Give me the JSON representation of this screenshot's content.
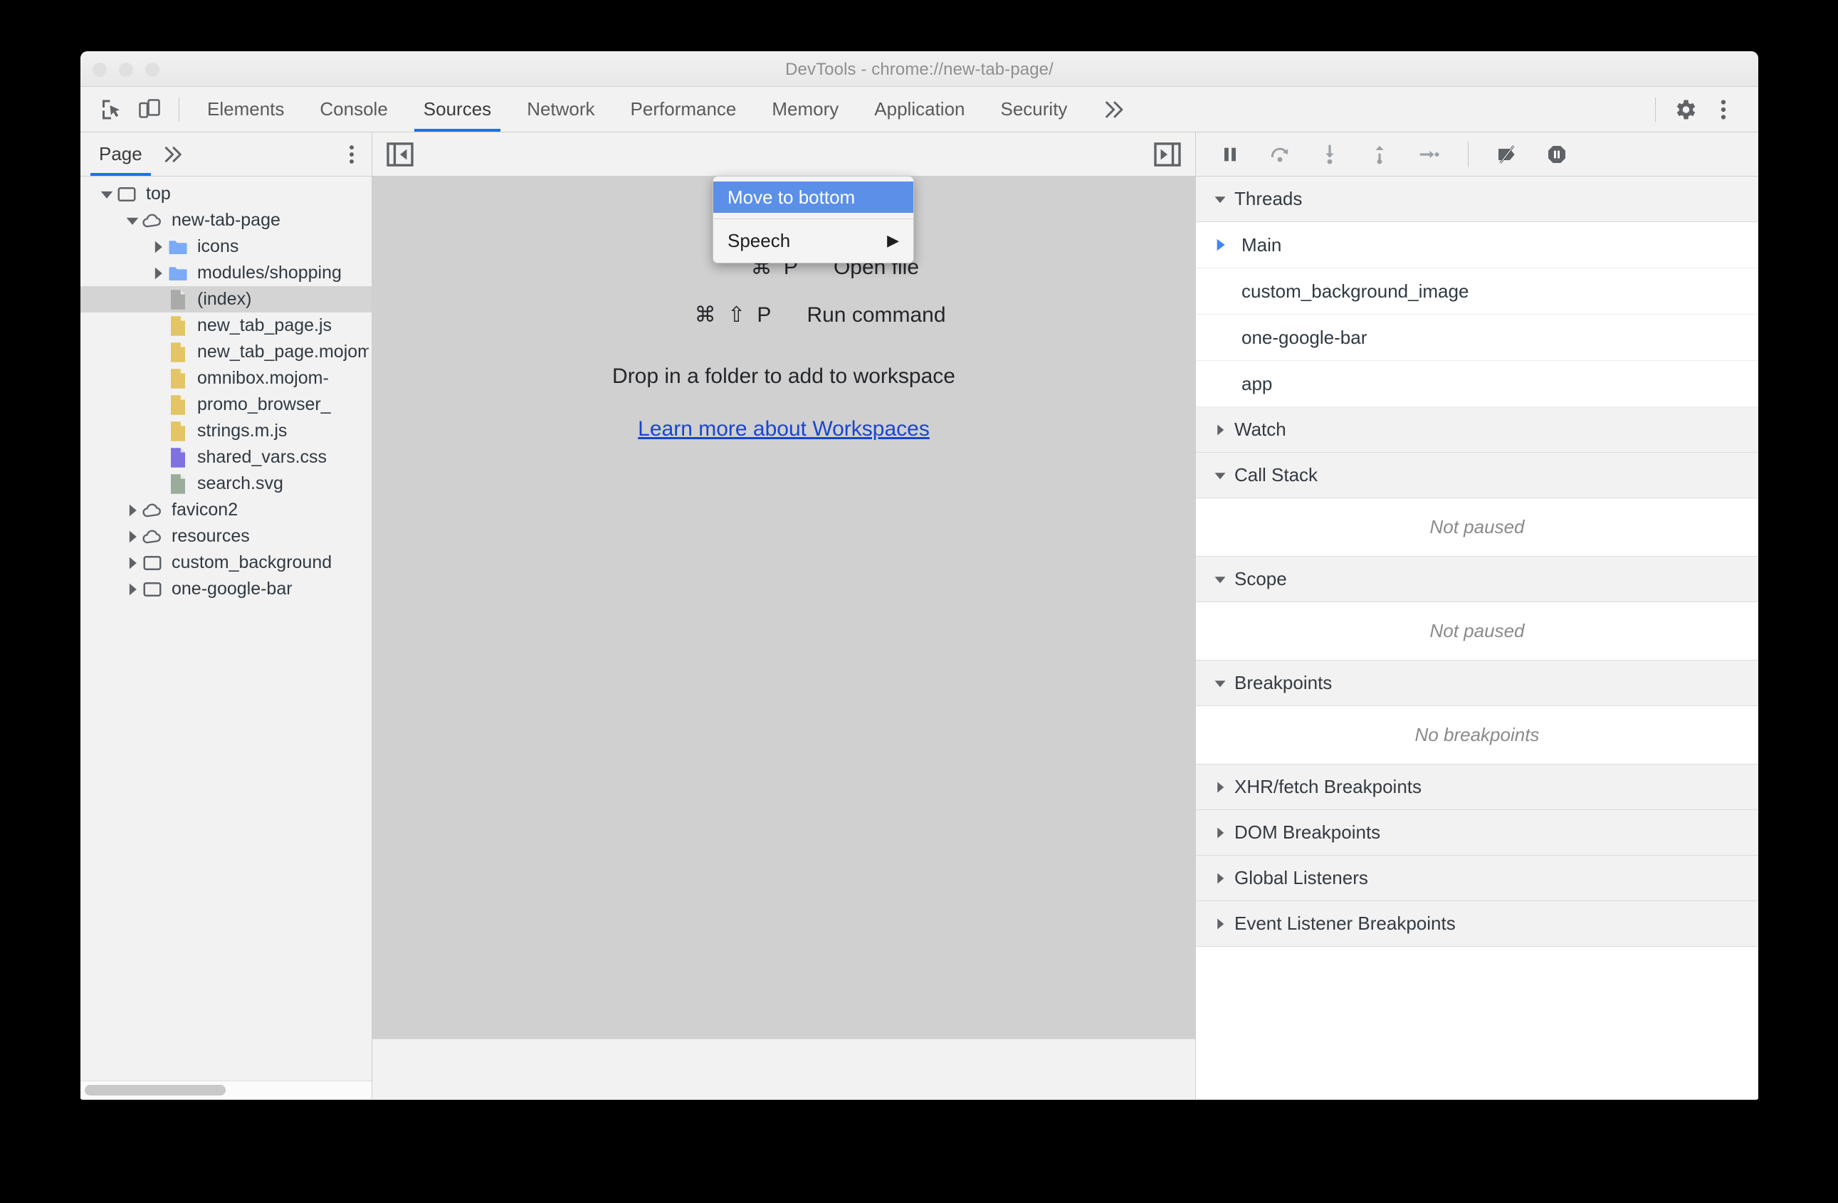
{
  "window": {
    "title": "DevTools - chrome://new-tab-page/",
    "traffic_lights": [
      "close",
      "minimize",
      "maximize"
    ]
  },
  "toolbar": {
    "inspect_icon": "inspect-cursor-icon",
    "device_icon": "device-toolbar-icon",
    "tabs": [
      {
        "label": "Elements",
        "active": false
      },
      {
        "label": "Console",
        "active": false
      },
      {
        "label": "Sources",
        "active": true
      },
      {
        "label": "Network",
        "active": false
      },
      {
        "label": "Performance",
        "active": false
      },
      {
        "label": "Memory",
        "active": false
      },
      {
        "label": "Application",
        "active": false
      },
      {
        "label": "Security",
        "active": false
      }
    ],
    "more_tabs_icon": "chevron-double-right-icon",
    "settings_icon": "gear-icon",
    "menu_icon": "kebab-menu-icon"
  },
  "context_menu": {
    "items": [
      {
        "label": "Move to bottom",
        "highlighted": true,
        "submenu": false
      },
      {
        "label": "Speech",
        "highlighted": false,
        "submenu": true
      }
    ],
    "submenu_arrow": "▶"
  },
  "navigator": {
    "tab_label": "Page",
    "more_icon": "chevron-double-right-icon",
    "kebab_icon": "kebab-menu-icon",
    "tree": [
      {
        "label": "top",
        "indent": 0,
        "arrow": "down",
        "icon": "frame-icon",
        "selected": false
      },
      {
        "label": "new-tab-page",
        "indent": 1,
        "arrow": "down",
        "icon": "cloud-icon",
        "selected": false
      },
      {
        "label": "icons",
        "indent": 2,
        "arrow": "right",
        "icon": "folder-icon",
        "selected": false
      },
      {
        "label": "modules/shopping",
        "indent": 2,
        "arrow": "right",
        "icon": "folder-icon",
        "selected": false
      },
      {
        "label": "(index)",
        "indent": 2,
        "arrow": "none",
        "icon": "doc-gray-icon",
        "selected": true
      },
      {
        "label": "new_tab_page.js",
        "indent": 2,
        "arrow": "none",
        "icon": "doc-js-icon",
        "selected": false
      },
      {
        "label": "new_tab_page.mojom",
        "indent": 2,
        "arrow": "none",
        "icon": "doc-js-icon",
        "selected": false
      },
      {
        "label": "omnibox.mojom-",
        "indent": 2,
        "arrow": "none",
        "icon": "doc-js-icon",
        "selected": false
      },
      {
        "label": "promo_browser_",
        "indent": 2,
        "arrow": "none",
        "icon": "doc-js-icon",
        "selected": false
      },
      {
        "label": "strings.m.js",
        "indent": 2,
        "arrow": "none",
        "icon": "doc-js-icon",
        "selected": false
      },
      {
        "label": "shared_vars.css",
        "indent": 2,
        "arrow": "none",
        "icon": "doc-css-icon",
        "selected": false
      },
      {
        "label": "search.svg",
        "indent": 2,
        "arrow": "none",
        "icon": "doc-svg-icon",
        "selected": false
      },
      {
        "label": "favicon2",
        "indent": 1,
        "arrow": "right",
        "icon": "cloud-icon",
        "selected": false
      },
      {
        "label": "resources",
        "indent": 1,
        "arrow": "right",
        "icon": "cloud-icon",
        "selected": false
      },
      {
        "label": "custom_background",
        "indent": 1,
        "arrow": "right",
        "icon": "frame-icon",
        "selected": false
      },
      {
        "label": "one-google-bar",
        "indent": 1,
        "arrow": "right",
        "icon": "frame-icon",
        "selected": false
      }
    ]
  },
  "editor": {
    "collapse_navigator_icon": "show-navigator-icon",
    "expand_debugger_icon": "show-debugger-icon",
    "shortcuts": [
      {
        "keys": "⌘ P",
        "label": "Open file"
      },
      {
        "keys": "⌘ ⇧ P",
        "label": "Run command"
      }
    ],
    "drop_hint": "Drop in a folder to add to workspace",
    "learn_more_link": "Learn more about Workspaces"
  },
  "debugger": {
    "buttons": [
      {
        "name": "resume-pause-button",
        "icon": "pause-icon"
      },
      {
        "name": "step-over-button",
        "icon": "step-over-icon"
      },
      {
        "name": "step-into-button",
        "icon": "step-into-icon"
      },
      {
        "name": "step-out-button",
        "icon": "step-out-icon"
      },
      {
        "name": "step-button",
        "icon": "step-icon"
      },
      {
        "name": "deactivate-breakpoints-button",
        "icon": "deactivate-breakpoints-icon"
      },
      {
        "name": "pause-on-exceptions-button",
        "icon": "pause-on-exceptions-icon"
      }
    ],
    "threads": {
      "title": "Threads",
      "expanded": true,
      "items": [
        {
          "label": "Main",
          "current": true
        },
        {
          "label": "custom_background_image",
          "current": false
        },
        {
          "label": "one-google-bar",
          "current": false
        },
        {
          "label": "app",
          "current": false
        }
      ]
    },
    "sections": [
      {
        "title": "Watch",
        "expanded": false,
        "empty_text": null
      },
      {
        "title": "Call Stack",
        "expanded": true,
        "empty_text": "Not paused"
      },
      {
        "title": "Scope",
        "expanded": true,
        "empty_text": "Not paused"
      },
      {
        "title": "Breakpoints",
        "expanded": true,
        "empty_text": "No breakpoints"
      },
      {
        "title": "XHR/fetch Breakpoints",
        "expanded": false,
        "empty_text": null
      },
      {
        "title": "DOM Breakpoints",
        "expanded": false,
        "empty_text": null
      },
      {
        "title": "Global Listeners",
        "expanded": false,
        "empty_text": null
      },
      {
        "title": "Event Listener Breakpoints",
        "expanded": false,
        "empty_text": null
      }
    ]
  },
  "colors": {
    "accent": "#1a73e8",
    "menu_highlight": "#5b8fe8",
    "link": "#1a44d0",
    "folder": "#7baaf7",
    "js_file": "#e3c565",
    "css_file": "#7f72e0",
    "svg_file": "#9aad9a",
    "content_bg": "#d0d0d0"
  }
}
